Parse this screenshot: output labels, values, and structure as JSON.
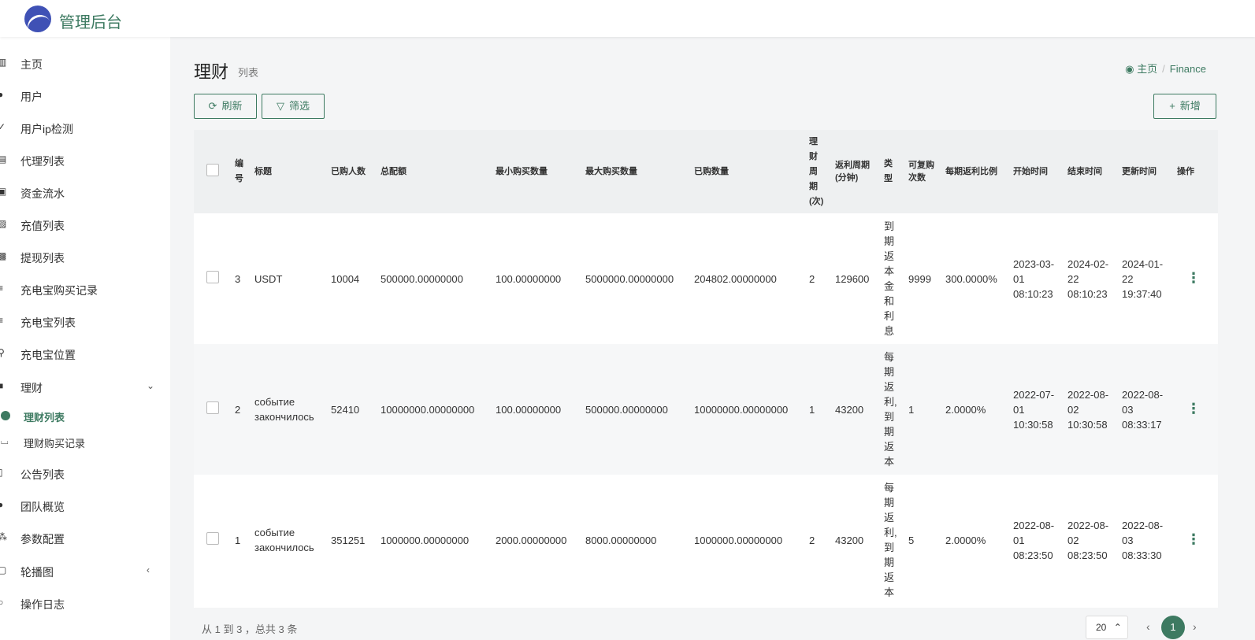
{
  "app": {
    "brand": "管理后台"
  },
  "sidebar": {
    "items": [
      {
        "label": "主页",
        "icon": "bar-chart-icon"
      },
      {
        "label": "用户",
        "icon": "user-icon"
      },
      {
        "label": "用户ip检测",
        "icon": "check-icon"
      },
      {
        "label": "代理列表",
        "icon": "list-icon"
      },
      {
        "label": "资金流水",
        "icon": "money-icon"
      },
      {
        "label": "充值列表",
        "icon": "recharge-icon"
      },
      {
        "label": "提现列表",
        "icon": "withdraw-icon"
      },
      {
        "label": "充电宝购买记录",
        "icon": "bars-icon"
      },
      {
        "label": "充电宝列表",
        "icon": "bars-icon"
      },
      {
        "label": "充电宝位置",
        "icon": "location-icon"
      },
      {
        "label": "理财",
        "icon": "folder-icon"
      },
      {
        "label": "理财列表",
        "icon": "circle-icon"
      },
      {
        "label": "理财购买记录",
        "icon": "bath-icon"
      },
      {
        "label": "公告列表",
        "icon": "file-icon"
      },
      {
        "label": "团队概览",
        "icon": "users-icon"
      },
      {
        "label": "参数配置",
        "icon": "sitemap-icon"
      },
      {
        "label": "轮播图",
        "icon": "image-icon"
      },
      {
        "label": "操作日志",
        "icon": "history-icon"
      }
    ]
  },
  "header": {
    "title": "理财",
    "subtitle": "列表",
    "breadcrumb": {
      "home": "主页",
      "current": "Finance"
    }
  },
  "toolbar": {
    "refresh_label": "刷新",
    "filter_label": "筛选",
    "add_label": "新增"
  },
  "table": {
    "columns": [
      "编号",
      "标题",
      "已购人数",
      "总配额",
      "最小购买数量",
      "最大购买数量",
      "已购数量",
      "理财周期(次)",
      "返利周期(分钟)",
      "类型",
      "可复购次数",
      "每期返利比例",
      "开始时间",
      "结束时间",
      "更新时间",
      "操作"
    ],
    "rows": [
      {
        "id": "3",
        "title": "USDT",
        "buyers": "10004",
        "total_quota": "500000.00000000",
        "min_buy": "100.00000000",
        "max_buy": "5000000.00000000",
        "bought": "204802.00000000",
        "period": "2",
        "rebate_period": "129600",
        "type": "到期返本金和利息",
        "repurchase": "9999",
        "rebate_ratio": "300.0000%",
        "start": "2023-03-01 08:10:23",
        "end": "2024-02-22 08:10:23",
        "updated": "2024-01-22 19:37:40"
      },
      {
        "id": "2",
        "title": "событие закончилось",
        "buyers": "52410",
        "total_quota": "10000000.00000000",
        "min_buy": "100.00000000",
        "max_buy": "500000.00000000",
        "bought": "10000000.00000000",
        "period": "1",
        "rebate_period": "43200",
        "type": "每期返利,到期返本",
        "repurchase": "1",
        "rebate_ratio": "2.0000%",
        "start": "2022-07-01 10:30:58",
        "end": "2022-08-02 10:30:58",
        "updated": "2022-08-03 08:33:17"
      },
      {
        "id": "1",
        "title": "событие закончилось",
        "buyers": "351251",
        "total_quota": "1000000.00000000",
        "min_buy": "2000.00000000",
        "max_buy": "8000.00000000",
        "bought": "1000000.00000000",
        "period": "2",
        "rebate_period": "43200",
        "type": "每期返利,到期返本",
        "repurchase": "5",
        "rebate_ratio": "2.0000%",
        "start": "2022-08-01 08:23:50",
        "end": "2022-08-02 08:23:50",
        "updated": "2022-08-03 08:33:30"
      }
    ]
  },
  "footer": {
    "summary": "从 1 到 3 ，总共 3 条",
    "page_size": "20",
    "current_page": "1"
  },
  "colors": {
    "accent": "#3d7a61",
    "logo": "#3f51b5"
  }
}
